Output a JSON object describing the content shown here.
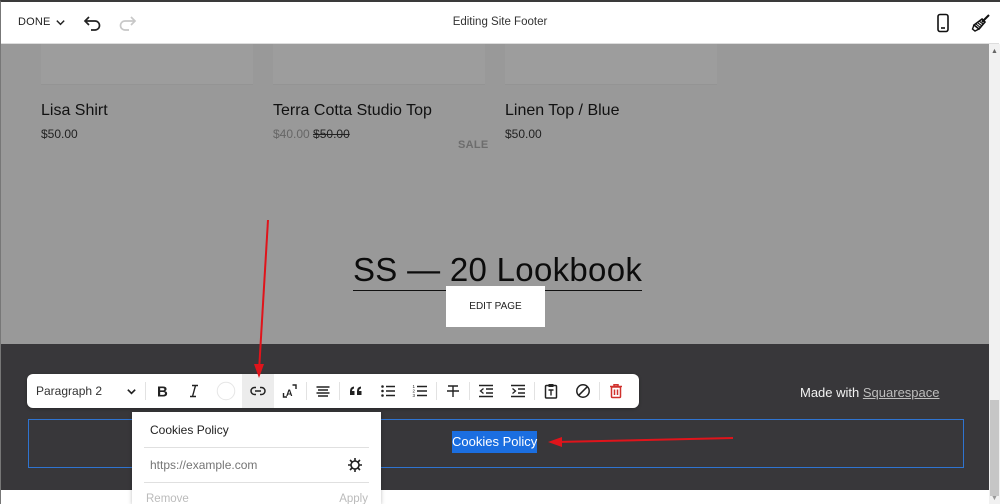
{
  "topbar": {
    "done_label": "DONE",
    "title": "Editing Site Footer",
    "icons": [
      "chevron-down-icon",
      "undo-icon",
      "redo-icon",
      "mobile-preview-icon",
      "paintbrush-icon"
    ]
  },
  "products": [
    {
      "name": "Lisa Shirt",
      "price": "$50.00"
    },
    {
      "name": "Terra Cotta Studio Top",
      "sale_price": "$40.00",
      "original_price": "$50.00",
      "badge": "SALE"
    },
    {
      "name": "Linen Top / Blue",
      "price": "$50.00"
    }
  ],
  "page": {
    "heading": "SS — 20 Lookbook",
    "edit_page_label": "EDIT PAGE"
  },
  "footer": {
    "made_with_prefix": "Made with ",
    "made_with_link": "Squarespace",
    "selected_link_text": "Cookies Policy"
  },
  "toolbar": {
    "paragraph_style": "Paragraph 2",
    "buttons": [
      {
        "name": "bold",
        "icon": "bold-icon"
      },
      {
        "name": "italic",
        "icon": "italic-icon"
      },
      {
        "name": "text-color",
        "icon": "color-circle-icon"
      },
      {
        "name": "link",
        "icon": "link-icon",
        "active": true
      },
      {
        "name": "text-size",
        "icon": "font-size-icon"
      },
      {
        "name": "align",
        "icon": "align-center-icon"
      },
      {
        "name": "quote",
        "icon": "quote-icon"
      },
      {
        "name": "bulleted-list",
        "icon": "bulleted-list-icon"
      },
      {
        "name": "numbered-list",
        "icon": "numbered-list-icon"
      },
      {
        "name": "strikethrough",
        "icon": "strikethrough-icon"
      },
      {
        "name": "outdent",
        "icon": "outdent-icon"
      },
      {
        "name": "indent",
        "icon": "indent-icon"
      },
      {
        "name": "paste-plain-text",
        "icon": "clipboard-text-icon"
      },
      {
        "name": "clear-formatting",
        "icon": "clear-format-icon"
      },
      {
        "name": "delete",
        "icon": "trash-icon"
      }
    ]
  },
  "link_popover": {
    "title": "Cookies Policy",
    "url_placeholder": "https://example.com",
    "url_value": "",
    "remove_label": "Remove",
    "apply_label": "Apply"
  },
  "colors": {
    "accent_blue": "#1b6ee0",
    "footer_bg": "#38373a",
    "canvas_overlay": "#999999",
    "delete_red": "#d0312d",
    "annotation_red": "#e0141b"
  }
}
